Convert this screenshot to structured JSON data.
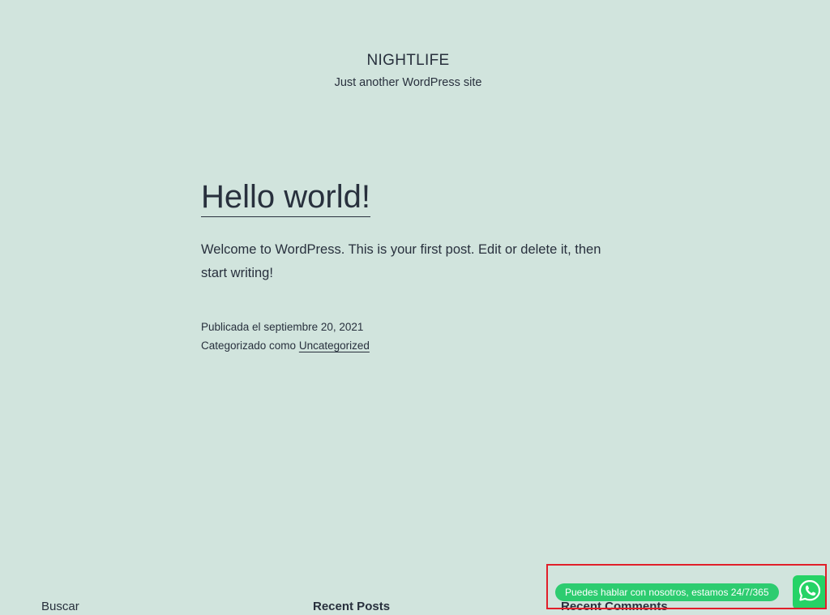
{
  "header": {
    "site_title": "NIGHTLIFE",
    "site_description": "Just another WordPress site"
  },
  "post": {
    "title": "Hello world!",
    "content": "Welcome to WordPress. This is your first post. Edit or delete it, then start writing!",
    "published_prefix": "Publicada el ",
    "published_date": "septiembre 20, 2021",
    "category_prefix": "Categorizado como ",
    "category": "Uncategorized"
  },
  "widgets": {
    "search_title": "Buscar",
    "recent_posts_title": "Recent Posts",
    "recent_comments_title": "Recent Comments"
  },
  "whatsapp": {
    "message": "Puedes hablar con nosotros, estamos 24/7/365",
    "icon": "whatsapp-icon",
    "color": "#25d366"
  },
  "colors": {
    "background": "#d1e4dd",
    "text": "#28303d",
    "highlight_border": "#e11f2a"
  }
}
